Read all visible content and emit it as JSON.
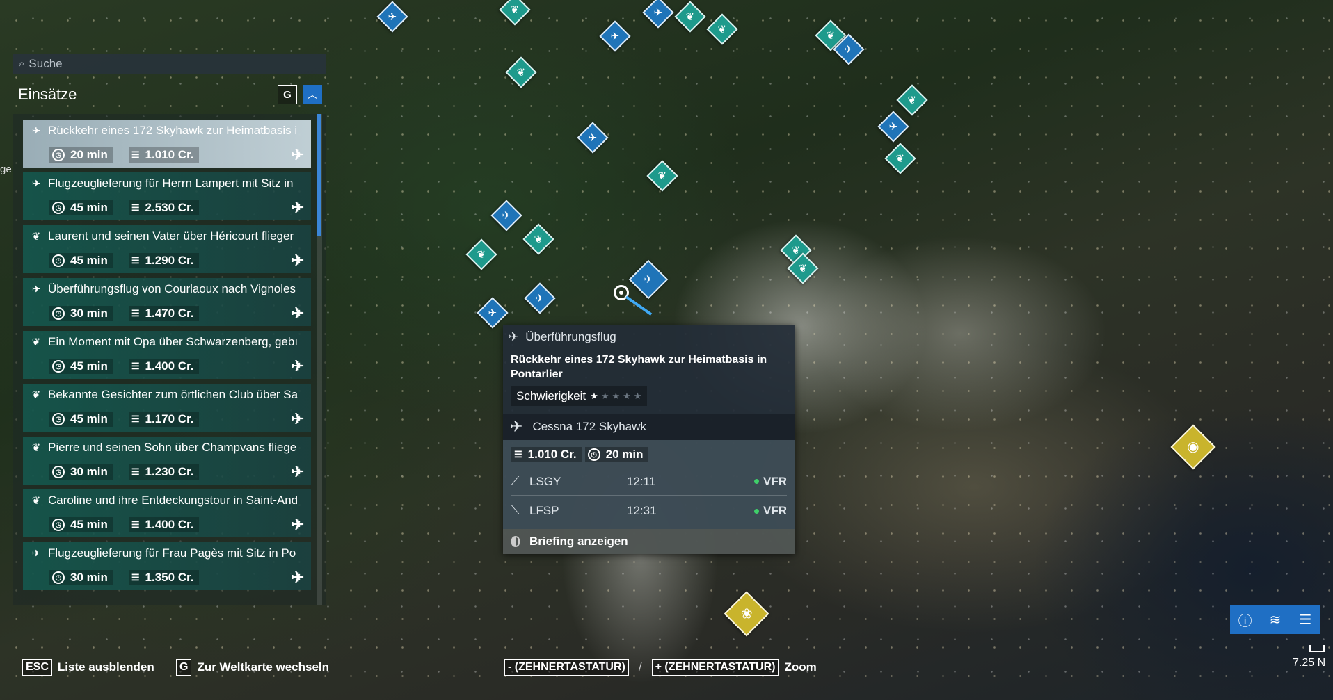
{
  "search": {
    "placeholder": "Suche"
  },
  "panel": {
    "title": "Einsätze",
    "g_key": "G",
    "collapse_icon": "chevron-up-icon"
  },
  "missions": [
    {
      "type": "delivery",
      "title": "Rückkehr eines 172 Skyhawk zur Heimatbasis i",
      "duration": "20 min",
      "credits": "1.010 Cr."
    },
    {
      "type": "delivery",
      "title": "Flugzeuglieferung für Herrn Lampert mit Sitz in",
      "duration": "45 min",
      "credits": "2.530 Cr."
    },
    {
      "type": "leaf",
      "title": "Laurent und seinen Vater über Héricourt flieger",
      "duration": "45 min",
      "credits": "1.290 Cr."
    },
    {
      "type": "delivery",
      "title": "Überführungsflug von Courlaoux nach Vignoles",
      "duration": "30 min",
      "credits": "1.470 Cr."
    },
    {
      "type": "leaf",
      "title": "Ein Moment mit Opa über Schwarzenberg, gebı",
      "duration": "45 min",
      "credits": "1.400 Cr."
    },
    {
      "type": "leaf",
      "title": "Bekannte Gesichter zum örtlichen Club über Sa",
      "duration": "45 min",
      "credits": "1.170 Cr."
    },
    {
      "type": "leaf",
      "title": "Pierre und seinen Sohn über Champvans fliege",
      "duration": "30 min",
      "credits": "1.230 Cr."
    },
    {
      "type": "leaf",
      "title": "Caroline und ihre Entdeckungstour in Saint-And",
      "duration": "45 min",
      "credits": "1.400 Cr."
    },
    {
      "type": "delivery",
      "title": "Flugzeuglieferung für Frau Pagès mit Sitz in Po",
      "duration": "30 min",
      "credits": "1.350 Cr."
    }
  ],
  "popup": {
    "type_label": "Überführungsflug",
    "title": "Rückkehr eines 172 Skyhawk zur Heimatbasis in Pontarlier",
    "difficulty_label": "Schwierigkeit",
    "difficulty_stars": 1,
    "difficulty_max": 5,
    "aircraft": "Cessna 172 Skyhawk",
    "credits": "1.010 Cr.",
    "duration": "20 min",
    "departure": {
      "code": "LSGY",
      "time": "12:11",
      "rules": "VFR"
    },
    "arrival": {
      "code": "LFSP",
      "time": "12:31",
      "rules": "VFR"
    },
    "briefing_label": "Briefing anzeigen"
  },
  "footer": {
    "esc_key": "ESC",
    "esc_label": "Liste ausblenden",
    "g_key": "G",
    "g_label": "Zur Weltkarte wechseln",
    "minus_key": "- (ZEHNERTASTATUR)",
    "separator": "/",
    "plus_key": "+ (ZEHNERTASTATUR)",
    "zoom_label": "Zoom"
  },
  "scale_text": "7.25 N",
  "edge_text": "ge",
  "colors": {
    "accent": "#1f6fc4",
    "mission_blue": "#1f74b8",
    "mission_teal": "#1e9a8c",
    "poi_gold": "#c9b42c",
    "vfr_green": "#3fd06a"
  }
}
